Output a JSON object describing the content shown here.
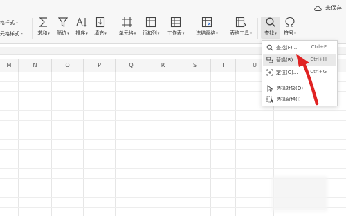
{
  "toolbar": {
    "cell_style_top": "格样式 -",
    "cell_style_bottom": "元格样式 -",
    "buttons": [
      {
        "label": "求和",
        "icon": "sum-icon"
      },
      {
        "label": "筛选",
        "icon": "filter-icon"
      },
      {
        "label": "排序",
        "icon": "sort-icon"
      },
      {
        "label": "填充",
        "icon": "fill-icon"
      },
      {
        "label": "单元格",
        "icon": "cell-icon"
      },
      {
        "label": "行和列",
        "icon": "row-col-icon"
      },
      {
        "label": "工作表",
        "icon": "worksheet-icon"
      },
      {
        "label": "冻结窗格",
        "icon": "freeze-panes-icon"
      },
      {
        "label": "表格工具",
        "icon": "table-tools-icon"
      },
      {
        "label": "查找",
        "icon": "search-icon"
      },
      {
        "label": "符号",
        "icon": "omega-icon"
      }
    ],
    "unsaved": "未保存"
  },
  "columns": [
    "M",
    "N",
    "O",
    "P",
    "Q",
    "R",
    "S",
    "T",
    "U"
  ],
  "find_menu": {
    "items": [
      {
        "label": "查找(F)...",
        "shortcut": "Ctrl+F",
        "icon": "search-icon"
      },
      {
        "label": "替换(R)...",
        "shortcut": "Ctrl+H",
        "icon": "replace-icon"
      },
      {
        "label": "定位(G)...",
        "shortcut": "Ctrl+G",
        "icon": "locate-icon"
      },
      {
        "label": "选择对象(O)",
        "shortcut": "",
        "icon": "select-object-icon"
      },
      {
        "label": "选择窗格(I)",
        "shortcut": "",
        "icon": "selection-pane-icon"
      }
    ],
    "highlighted_index": 1
  },
  "colors": {
    "arrow": "#e02222",
    "accent": "#2b6fd6"
  }
}
